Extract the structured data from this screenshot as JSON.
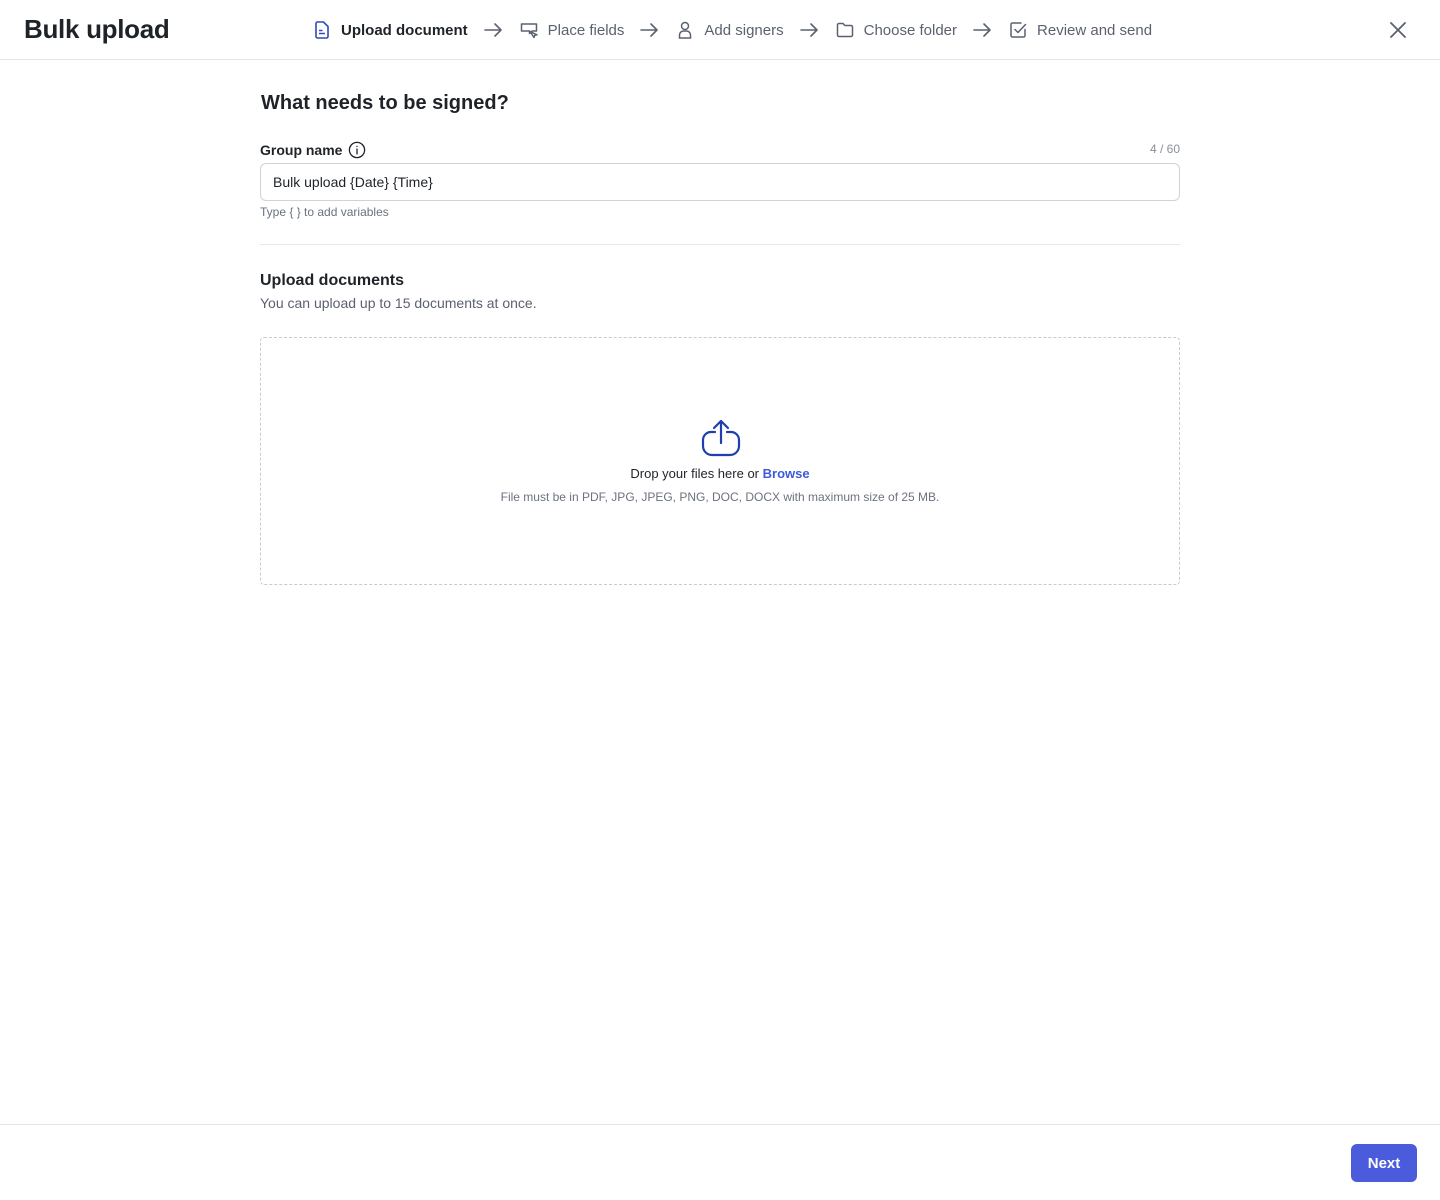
{
  "header": {
    "title": "Bulk upload",
    "steps": [
      {
        "label": "Upload document",
        "icon": "document-icon",
        "active": true
      },
      {
        "label": "Place fields",
        "icon": "field-icon",
        "active": false
      },
      {
        "label": "Add signers",
        "icon": "user-icon",
        "active": false
      },
      {
        "label": "Choose folder",
        "icon": "folder-icon",
        "active": false
      },
      {
        "label": "Review and send",
        "icon": "check-square-icon",
        "active": false
      }
    ],
    "close_icon": "close-icon"
  },
  "main": {
    "title": "What needs to be signed?",
    "group_name": {
      "label": "Group name",
      "counter": "4 / 60",
      "value": "Bulk upload {Date} {Time}",
      "hint": "Type { } to add variables"
    },
    "upload": {
      "title": "Upload documents",
      "subtitle": "You can upload up to 15 documents at once.",
      "drop_text": "Drop your files here or",
      "browse_label": "Browse",
      "requirements": "File must be in PDF, JPG, JPEG, PNG, DOC, DOCX with maximum size of 25 MB."
    }
  },
  "footer": {
    "next_label": "Next"
  },
  "colors": {
    "accent": "#4a5bdc",
    "link": "#3b5bdb",
    "active_step_icon": "#2f4bb8"
  }
}
